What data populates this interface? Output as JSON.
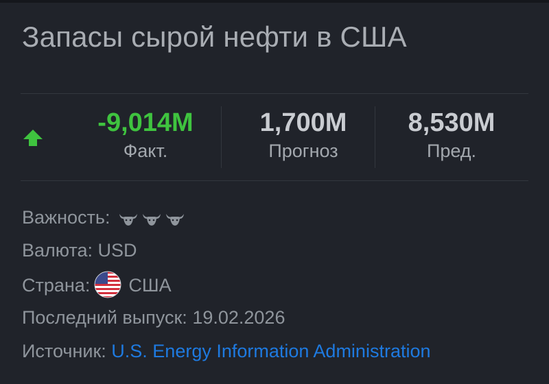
{
  "title": "Запасы сырой нефти в США",
  "stats": {
    "actual": {
      "value": "-9,014M",
      "label": "Факт."
    },
    "forecast": {
      "value": "1,700M",
      "label": "Прогноз"
    },
    "previous": {
      "value": "8,530M",
      "label": "Пред."
    },
    "trend_icon": "arrow-up-icon",
    "actual_color": "#3fc33f"
  },
  "info": {
    "importance": {
      "label": "Важность:",
      "level": 3,
      "max": 3,
      "icon": "bull-icon"
    },
    "currency": {
      "label": "Валюта:",
      "value": "USD"
    },
    "country": {
      "label": "Страна:",
      "value": "США",
      "icon": "us-flag-icon"
    },
    "last_release": {
      "label": "Последний выпуск:",
      "value": "19.02.2026"
    },
    "source": {
      "label": "Источник:",
      "value": "U.S. Energy Information Administration",
      "link_color": "#1e7ae0"
    }
  }
}
